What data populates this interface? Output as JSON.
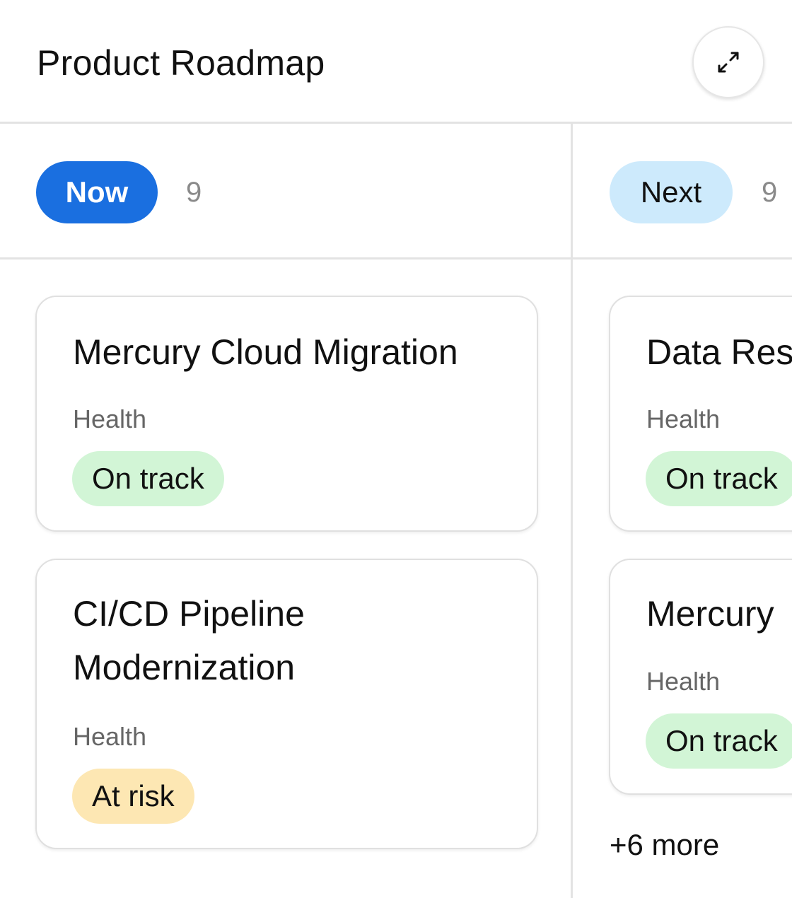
{
  "header": {
    "title": "Product Roadmap",
    "expand_icon": "expand-arrows-icon"
  },
  "columns": [
    {
      "stage": "Now",
      "count": "9",
      "cards": [
        {
          "title": "Mercury Cloud Migration",
          "health_label": "Health",
          "health": "On track"
        },
        {
          "title": "CI/CD Pipeline Modernization",
          "health_label": "Health",
          "health": "At risk"
        }
      ]
    },
    {
      "stage": "Next",
      "count": "9",
      "cards": [
        {
          "title": "Data Res",
          "health_label": "Health",
          "health": "On track"
        },
        {
          "title": "Mercury",
          "health_label": "Health",
          "health": "On track"
        }
      ],
      "more": "+6 more"
    }
  ],
  "colors": {
    "now_pill": "#1a6fe0",
    "next_pill": "#cdeafc",
    "on_track": "#d2f5d6",
    "at_risk": "#fde7b3"
  }
}
